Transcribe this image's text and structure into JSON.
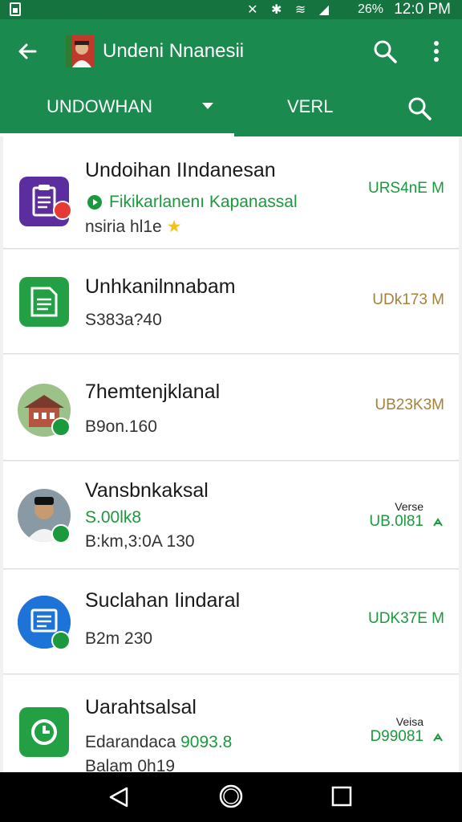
{
  "status_bar": {
    "battery": "26%",
    "time": "12:0 PM"
  },
  "toolbar": {
    "title": "Undeni Nnanesii"
  },
  "tabs": {
    "main_label": "UNDOWHAN",
    "second_label": "VERL"
  },
  "items": [
    {
      "title": "Undoihan IIndanesan",
      "line1": "Fikikarlanenı Kapanassal",
      "line2": "nsiria hl1e",
      "size": "URS4nE M"
    },
    {
      "title": "Unhkanilnnabam",
      "line1": "S383a?40",
      "size": "UDk173 M"
    },
    {
      "title": "7hemtenjklanal",
      "line1": "B9on.160",
      "size": "UB23K3M"
    },
    {
      "title": "Vansbnkaksal",
      "line1": "S.00lk8",
      "line2": "B:km,3:0A 130",
      "version_label": "Verse",
      "size": "UB.0l81"
    },
    {
      "title": "Suclahan Iindaral",
      "line1": "B2m 230",
      "size": "UDK37E M"
    },
    {
      "title": "Uarahtsalsal",
      "line1_prefix": "Edarandaca",
      "line1_value": "9093.8",
      "line2": "Balam 0h19",
      "version_label": "Veisa",
      "size": "D99081"
    }
  ],
  "colors": {
    "toolbar": "#1b8a4e",
    "status_bar": "#14733f",
    "accent_green": "#1a9a3c",
    "size_gold": "#a5813a"
  }
}
